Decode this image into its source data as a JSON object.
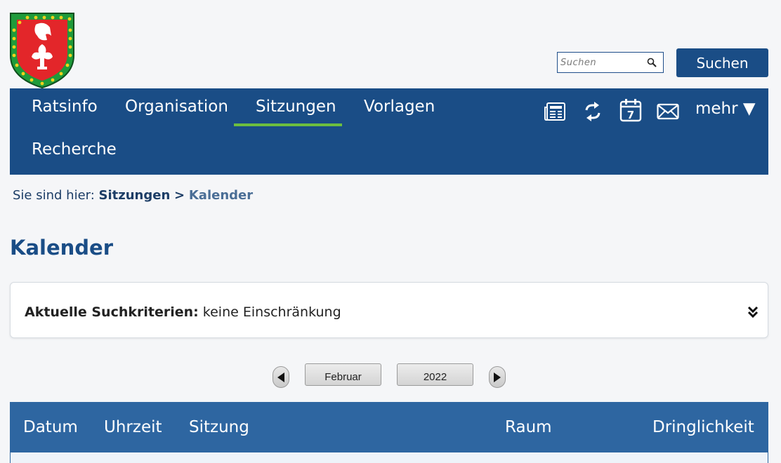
{
  "search": {
    "placeholder": "Suchen",
    "button_label": "Suchen"
  },
  "nav": {
    "items": [
      {
        "label": "Ratsinfo"
      },
      {
        "label": "Organisation"
      },
      {
        "label": "Sitzungen"
      },
      {
        "label": "Vorlagen"
      },
      {
        "label": "Recherche"
      }
    ],
    "active": "Sitzungen",
    "icons": [
      "news-icon",
      "sync-icon",
      "calendar-icon",
      "mail-icon"
    ],
    "calendar_day": "7",
    "more_label": "mehr ▼"
  },
  "breadcrumb": {
    "prefix": "Sie sind hier:",
    "parent": "Sitzungen",
    "separator": ">",
    "current": "Kalender"
  },
  "page": {
    "title": "Kalender"
  },
  "criteria": {
    "label": "Aktuelle Suchkriterien:",
    "value": "keine Einschränkung"
  },
  "calendar_nav": {
    "month": "Februar",
    "year": "2022"
  },
  "table": {
    "columns": [
      "Datum",
      "Uhrzeit",
      "Sitzung",
      "Raum",
      "Dringlichkeit"
    ]
  },
  "colors": {
    "primary": "#1a4d86",
    "table_header": "#2e66a1",
    "active_underline": "#6dbf3f",
    "background": "#f5f6f8"
  }
}
